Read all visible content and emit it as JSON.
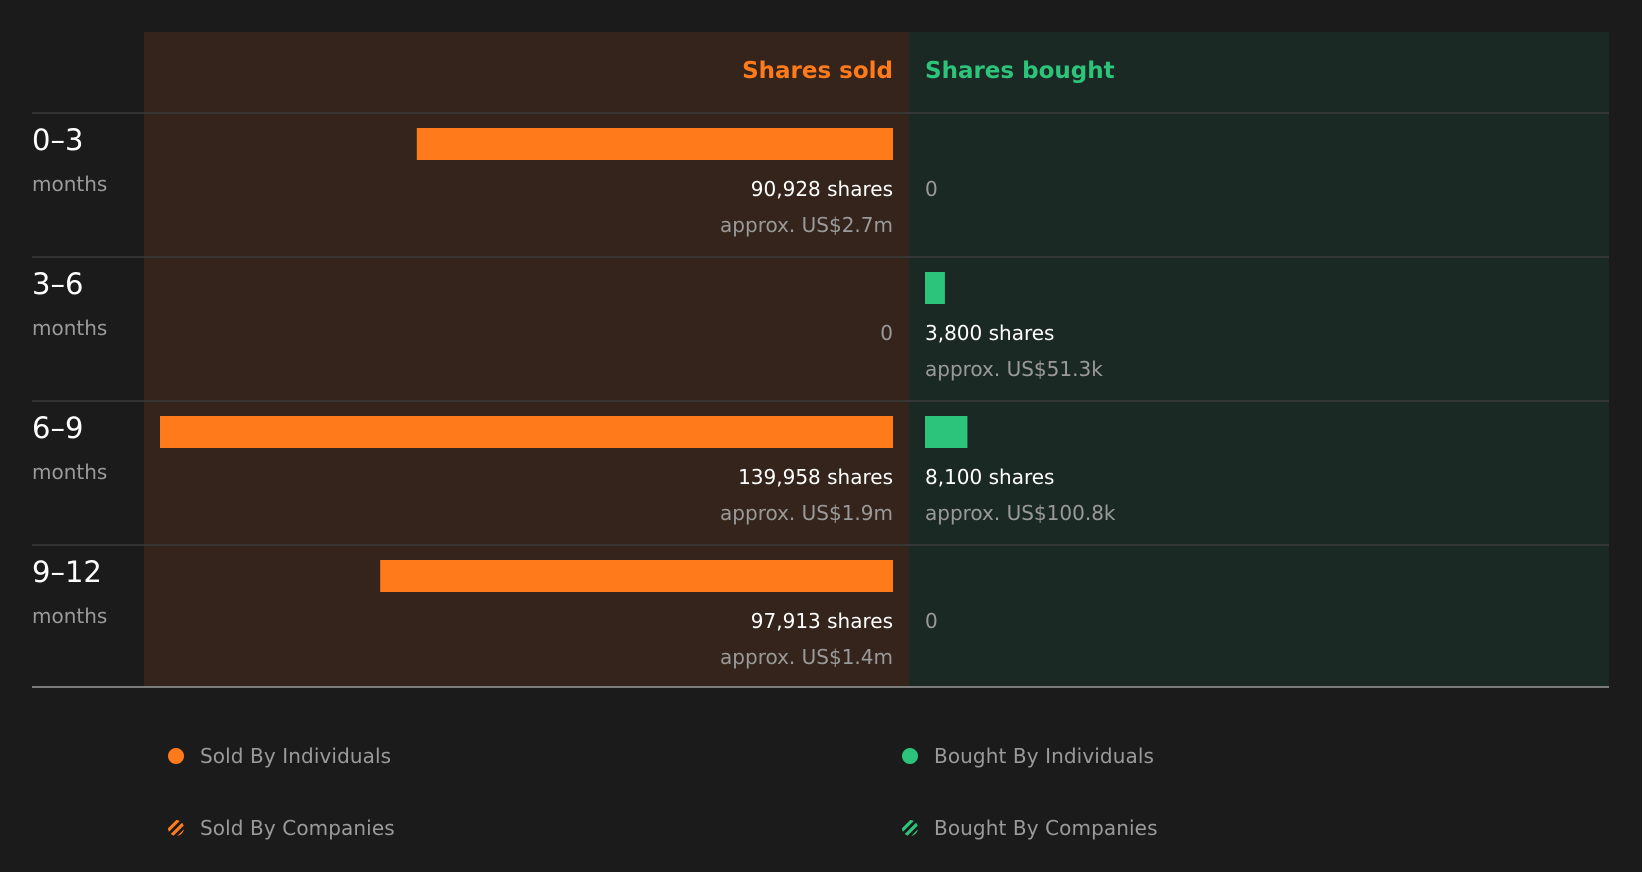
{
  "colors": {
    "background": "#1b1b1b",
    "sold_panel": "#34241b",
    "bought_panel": "#1b2924",
    "sold": "#ff7a1a",
    "bought": "#2cc47a",
    "text_primary": "#ffffff",
    "text_secondary": "#9a9a9a",
    "divider": "#3b3b3b"
  },
  "chart_data": {
    "type": "bar",
    "orientation": "horizontal-diverging",
    "headers": {
      "sold": "Shares sold",
      "bought": "Shares bought"
    },
    "categories": [
      {
        "range": "0–3",
        "unit": "months"
      },
      {
        "range": "3–6",
        "unit": "months"
      },
      {
        "range": "6–9",
        "unit": "months"
      },
      {
        "range": "9–12",
        "unit": "months"
      }
    ],
    "series": [
      {
        "name": "Shares sold",
        "values": [
          90928,
          0,
          139958,
          97913
        ],
        "labels": [
          "90,928 shares",
          "0",
          "139,958 shares",
          "97,913 shares"
        ],
        "approx": [
          "approx. US$2.7m",
          "",
          "approx. US$1.9m",
          "approx. US$1.4m"
        ]
      },
      {
        "name": "Shares bought",
        "values": [
          0,
          3800,
          8100,
          0
        ],
        "labels": [
          "0",
          "3,800 shares",
          "8,100 shares",
          "0"
        ],
        "approx": [
          "",
          "approx. US$51.3k",
          "approx. US$100.8k",
          ""
        ]
      }
    ],
    "scale_max": 139958,
    "legend": [
      {
        "label": "Sold By Individuals",
        "key": "sold-ind"
      },
      {
        "label": "Bought By Individuals",
        "key": "bought-ind"
      },
      {
        "label": "Sold By Companies",
        "key": "sold-co"
      },
      {
        "label": "Bought By Companies",
        "key": "bought-co"
      }
    ],
    "legend_placement": "bottom"
  }
}
